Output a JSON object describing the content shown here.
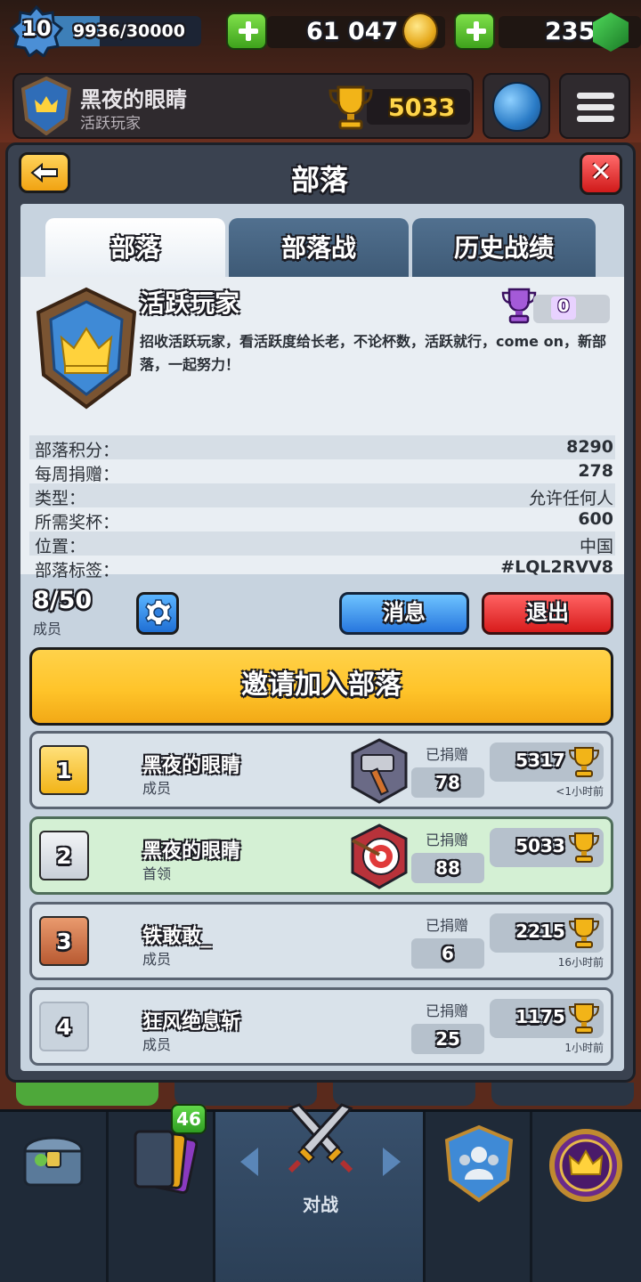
{
  "hud": {
    "level": "10",
    "xp_text": "9936/30000",
    "xp_progress": 0.331,
    "gold": "61 047",
    "gems": "235"
  },
  "profile": {
    "name": "黑夜的眼睛",
    "clan": "活跃玩家",
    "trophies": "5033"
  },
  "panel": {
    "title": "部落"
  },
  "tabs": [
    {
      "label": "部落"
    },
    {
      "label": "部落战"
    },
    {
      "label": "历史战绩"
    }
  ],
  "clan": {
    "name": "活跃玩家",
    "war_trophies": "0",
    "description": "招收活跃玩家，看活跃度给长老，不论杯数，活跃就行，come on，新部落，一起努力！",
    "stats": [
      {
        "label": "部落积分：",
        "value": "8290"
      },
      {
        "label": "每周捐赠：",
        "value": "278"
      },
      {
        "label": "类型：",
        "value": "允许任何人"
      },
      {
        "label": "所需奖杯：",
        "value": "600"
      },
      {
        "label": "位置：",
        "value": "中国"
      },
      {
        "label": "部落标签：",
        "value": "#LQL2RVV8"
      }
    ]
  },
  "members_bar": {
    "count": "8/50",
    "label": "成员",
    "message_label": "消息",
    "quit_label": "退出"
  },
  "invite_label": "邀请加入部落",
  "members": [
    {
      "rank": "1",
      "name": "黑夜的眼睛",
      "role": "成员",
      "donated_label": "已捐赠",
      "donated": "78",
      "trophies": "5317",
      "last_seen": "<1小时前"
    },
    {
      "rank": "2",
      "name": "黑夜的眼睛",
      "role": "首领",
      "donated_label": "已捐赠",
      "donated": "88",
      "trophies": "5033",
      "last_seen": ""
    },
    {
      "rank": "3",
      "name": "铁敢敢_",
      "role": "成员",
      "donated_label": "已捐赠",
      "donated": "6",
      "trophies": "2215",
      "last_seen": "16小时前"
    },
    {
      "rank": "4",
      "name": "狂风绝息斩",
      "role": "成员",
      "donated_label": "已捐赠",
      "donated": "25",
      "trophies": "1175",
      "last_seen": "1小时前"
    }
  ],
  "bottom_nav": {
    "cards_badge": "46",
    "battle_label": "对战"
  },
  "colors": {
    "gold_button": "#ffc42a",
    "blue_button": "#2777de",
    "red_button": "#d81c1c",
    "self_row": "#d4f0d4",
    "panel_bg": "#c7d3df"
  }
}
